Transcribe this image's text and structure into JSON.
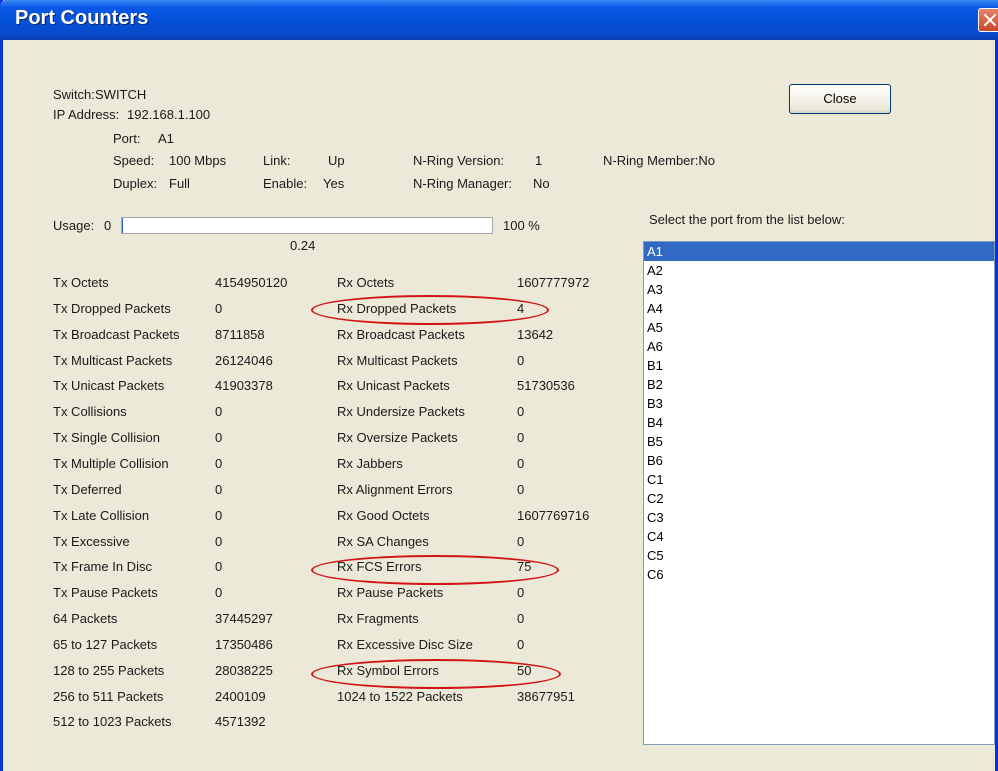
{
  "window": {
    "title": "Port Counters"
  },
  "info": {
    "switch_label": "Switch:",
    "switch_value": "SWITCH",
    "ip_label": "IP Address:",
    "ip_value": "192.168.1.100",
    "port_label": "Port:",
    "port_value": "A1",
    "speed_label": "Speed:",
    "speed_value": "100 Mbps",
    "link_label": "Link:",
    "link_value": "Up",
    "nring_version_label": "N-Ring Version:",
    "nring_version_value": "1",
    "nring_member": "N-Ring Member:No",
    "duplex_label": "Duplex:",
    "duplex_value": "Full",
    "enable_label": "Enable:",
    "enable_value": "Yes",
    "nring_manager_label": "N-Ring Manager:",
    "nring_manager_value": "No"
  },
  "usage": {
    "label": "Usage:",
    "min": "0",
    "max_label": "100 %",
    "value": "0.24",
    "fraction": 0.0024
  },
  "buttons": {
    "close": "Close"
  },
  "port_list": {
    "label": "Select the port from the list below:",
    "selected": "A1",
    "items": [
      "A1",
      "A2",
      "A3",
      "A4",
      "A5",
      "A6",
      "B1",
      "B2",
      "B3",
      "B4",
      "B5",
      "B6",
      "C1",
      "C2",
      "C3",
      "C4",
      "C5",
      "C6"
    ]
  },
  "counters": {
    "tx": [
      {
        "label": "Tx Octets",
        "value": "4154950120"
      },
      {
        "label": "Tx Dropped Packets",
        "value": "0"
      },
      {
        "label": "Tx Broadcast Packets",
        "value": "8711858"
      },
      {
        "label": "Tx Multicast Packets",
        "value": "26124046"
      },
      {
        "label": "Tx Unicast Packets",
        "value": "41903378"
      },
      {
        "label": "Tx Collisions",
        "value": "0"
      },
      {
        "label": "Tx Single Collision",
        "value": "0"
      },
      {
        "label": "Tx Multiple Collision",
        "value": "0"
      },
      {
        "label": "Tx Deferred",
        "value": "0"
      },
      {
        "label": "Tx Late Collision",
        "value": "0"
      },
      {
        "label": "Tx Excessive",
        "value": "0"
      },
      {
        "label": "Tx Frame In Disc",
        "value": "0"
      },
      {
        "label": "Tx Pause Packets",
        "value": "0"
      },
      {
        "label": "64 Packets",
        "value": "37445297"
      },
      {
        "label": "65 to 127 Packets",
        "value": "17350486"
      },
      {
        "label": "128 to 255 Packets",
        "value": "28038225"
      },
      {
        "label": "256 to 511 Packets",
        "value": "2400109"
      },
      {
        "label": "512 to 1023 Packets",
        "value": "4571392"
      }
    ],
    "rx": [
      {
        "label": "Rx Octets",
        "value": "1607777972"
      },
      {
        "label": "Rx Dropped Packets",
        "value": "4"
      },
      {
        "label": "Rx Broadcast Packets",
        "value": "13642"
      },
      {
        "label": "Rx Multicast Packets",
        "value": "0"
      },
      {
        "label": "Rx Unicast Packets",
        "value": "51730536"
      },
      {
        "label": "Rx Undersize Packets",
        "value": "0"
      },
      {
        "label": "Rx Oversize Packets",
        "value": "0"
      },
      {
        "label": "Rx Jabbers",
        "value": "0"
      },
      {
        "label": "Rx Alignment Errors",
        "value": "0"
      },
      {
        "label": "Rx Good Octets",
        "value": "1607769716"
      },
      {
        "label": "Rx SA Changes",
        "value": "0"
      },
      {
        "label": "Rx FCS Errors",
        "value": "75"
      },
      {
        "label": "Rx Pause Packets",
        "value": "0"
      },
      {
        "label": "Rx Fragments",
        "value": "0"
      },
      {
        "label": "Rx Excessive Disc Size",
        "value": "0"
      },
      {
        "label": "Rx Symbol Errors",
        "value": "50"
      },
      {
        "label": "1024 to 1522 Packets",
        "value": "38677951"
      }
    ]
  },
  "highlight_color": "#d21414"
}
